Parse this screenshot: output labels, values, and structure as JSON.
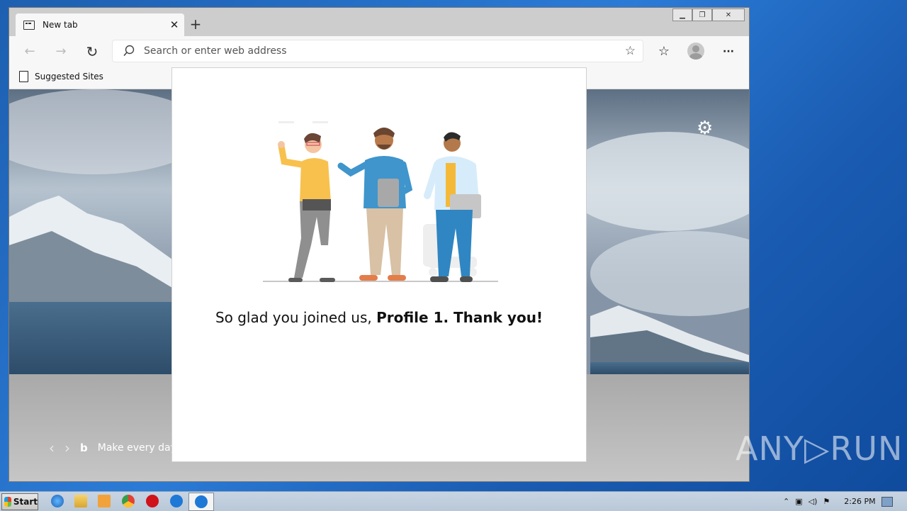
{
  "window": {
    "minimize_glyph": "▁",
    "maximize_glyph": "❐",
    "close_glyph": "✕"
  },
  "tab": {
    "title": "New tab",
    "close_glyph": "✕",
    "new_tab_glyph": "+"
  },
  "toolbar": {
    "back_glyph": "←",
    "forward_glyph": "→",
    "refresh_glyph": "↻",
    "address_placeholder": "Search or enter web address",
    "star_glyph": "☆",
    "favorites_glyph": "☆",
    "more_glyph": "···"
  },
  "favorites_bar": {
    "item_label": "Suggested Sites"
  },
  "newtab": {
    "bing_text": "Make every day",
    "gear_glyph": "⚙",
    "prev_glyph": "‹",
    "next_glyph": "›",
    "bing_glyph": "b"
  },
  "dialog": {
    "message_plain": "So glad you joined us, ",
    "message_bold": "Profile 1. Thank you!"
  },
  "taskbar": {
    "start_label": "Start",
    "clock": "2:26 PM"
  },
  "watermark": {
    "text": "ANY▷RUN"
  }
}
